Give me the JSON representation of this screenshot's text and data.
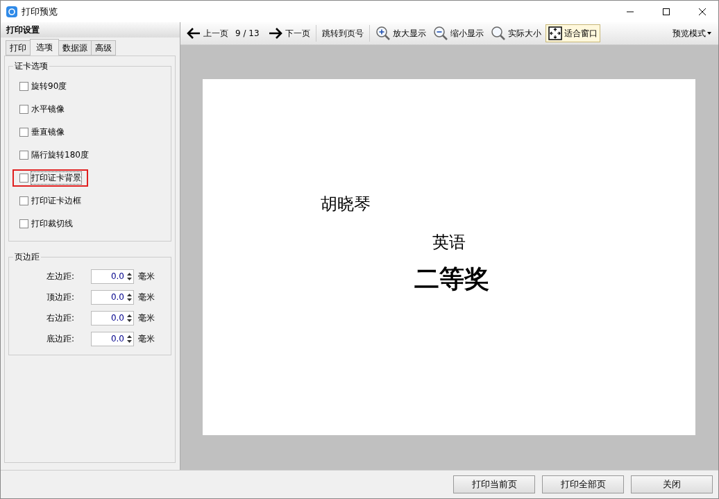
{
  "window": {
    "title": "打印预览"
  },
  "settings": {
    "title": "打印设置",
    "tabs": [
      {
        "label": "打印",
        "selected": false
      },
      {
        "label": "选项",
        "selected": true
      },
      {
        "label": "数据源",
        "selected": false
      },
      {
        "label": "高级",
        "selected": false
      }
    ],
    "card_options": {
      "title": "证卡选项",
      "items": [
        {
          "label": "旋转90度",
          "checked": false,
          "highlighted": false
        },
        {
          "label": "水平镜像",
          "checked": false,
          "highlighted": false
        },
        {
          "label": "垂直镜像",
          "checked": false,
          "highlighted": false
        },
        {
          "label": "隔行旋转180度",
          "checked": false,
          "highlighted": false
        },
        {
          "label": "打印证卡背景",
          "checked": false,
          "highlighted": true
        },
        {
          "label": "打印证卡边框",
          "checked": false,
          "highlighted": false
        },
        {
          "label": "打印裁切线",
          "checked": false,
          "highlighted": false
        }
      ]
    },
    "margins": {
      "title": "页边距",
      "rows": [
        {
          "label": "左边距:",
          "value": "0.0",
          "unit": "毫米"
        },
        {
          "label": "顶边距:",
          "value": "0.0",
          "unit": "毫米"
        },
        {
          "label": "右边距:",
          "value": "0.0",
          "unit": "毫米"
        },
        {
          "label": "底边距:",
          "value": "0.0",
          "unit": "毫米"
        }
      ]
    }
  },
  "toolbar": {
    "items": [
      {
        "kind": "prev",
        "label": "上一页",
        "selected": false
      },
      {
        "kind": "counter",
        "label": "9 / 13"
      },
      {
        "kind": "next",
        "label": "下一页",
        "selected": false
      },
      {
        "kind": "separator"
      },
      {
        "kind": "plain",
        "label": "跳转到页号",
        "selected": false
      },
      {
        "kind": "separator"
      },
      {
        "kind": "zoom-in",
        "label": "放大显示",
        "selected": false
      },
      {
        "kind": "zoom-out",
        "label": "缩小显示",
        "selected": false
      },
      {
        "kind": "actual",
        "label": "实际大小",
        "selected": false
      },
      {
        "kind": "fit",
        "label": "适合窗口",
        "selected": true
      }
    ],
    "mode": "预览模式"
  },
  "preview": {
    "texts": [
      {
        "kind": "name",
        "text": "胡晓琴"
      },
      {
        "kind": "subject",
        "text": "英语"
      },
      {
        "kind": "award",
        "text": "二等奖"
      }
    ]
  },
  "buttons": [
    "打印当前页",
    "打印全部页",
    "关闭"
  ]
}
